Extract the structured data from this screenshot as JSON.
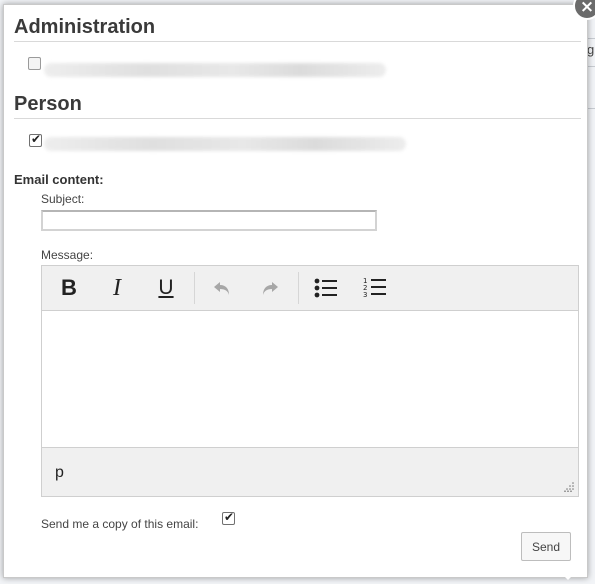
{
  "dialog": {
    "close_label": "×",
    "sections": [
      {
        "title": "Administration",
        "checked": false
      },
      {
        "title": "Person",
        "checked": true
      }
    ],
    "email_content_label": "Email content:",
    "subject_label": "Subject:",
    "subject_value": "",
    "message_label": "Message:",
    "toolbar": [
      {
        "name": "bold-icon",
        "label": "B"
      },
      {
        "name": "italic-icon",
        "label": "I"
      },
      {
        "name": "underline-icon",
        "label": "U"
      },
      {
        "name": "undo-icon",
        "label": ""
      },
      {
        "name": "redo-icon",
        "label": ""
      },
      {
        "name": "bullet-list-icon",
        "label": ""
      },
      {
        "name": "numbered-list-icon",
        "label": ""
      }
    ],
    "editor_path": "p",
    "copy_label": "Send me a copy of this email:",
    "copy_checked": true,
    "send_label": "Send"
  },
  "background": {
    "edge_char": "g"
  }
}
